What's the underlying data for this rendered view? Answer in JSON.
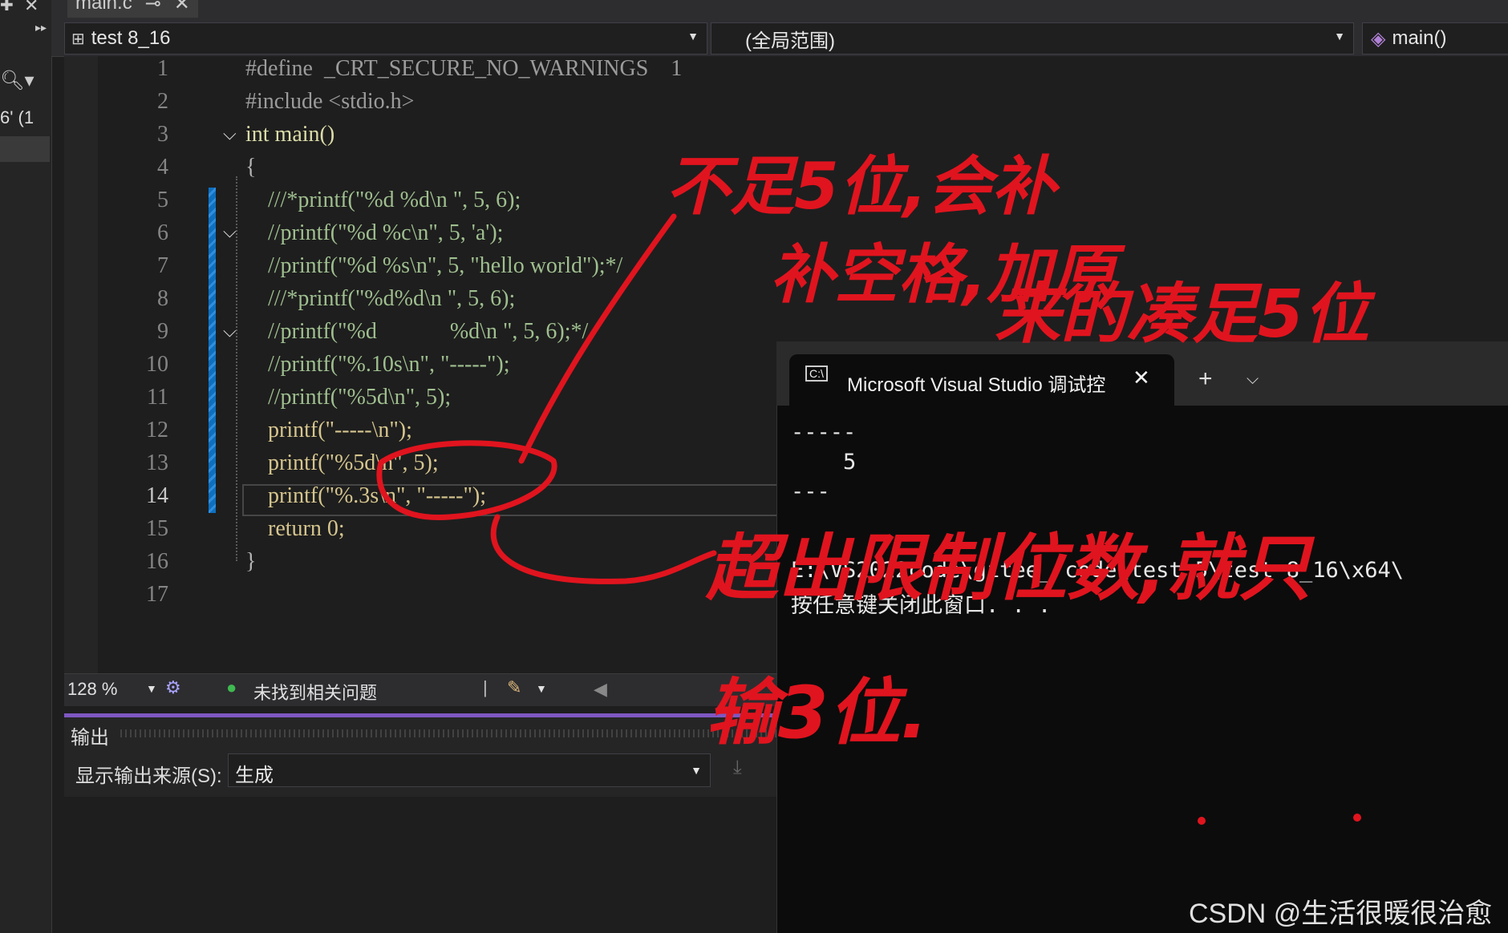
{
  "tab": {
    "title": "main.c",
    "pin_icon": "pin-icon",
    "close_icon": "close-icon"
  },
  "left_strip": {
    "search_icon": "search-icon",
    "crumb": "6' (1"
  },
  "navbar": {
    "project": "test 8_16",
    "scope": "(全局范围)",
    "function": "main()"
  },
  "editor": {
    "line_numbers": [
      "1",
      "2",
      "3",
      "4",
      "5",
      "6",
      "7",
      "8",
      "9",
      "10",
      "11",
      "12",
      "13",
      "14",
      "15",
      "16",
      "17"
    ],
    "lines": [
      "#define  _CRT_SECURE_NO_WARNINGS    1",
      "#include <stdio.h>",
      "int main()",
      "{",
      "    ///*printf(\"%d %d\\n \", 5, 6);",
      "    //printf(\"%d %c\\n\", 5, 'a');",
      "    //printf(\"%d %s\\n\", 5, \"hello world\");*/",
      "    ///*printf(\"%d%d\\n \", 5, 6);",
      "    //printf(\"%d             %d\\n \", 5, 6);*/",
      "    //printf(\"%.10s\\n\", \"-----\");",
      "    //printf(\"%5d\\n\", 5);",
      "    printf(\"-----\\n\");",
      "    printf(\"%5d\\n\", 5);",
      "    printf(\"%.3s\\n\", \"-----\");",
      "    return 0;",
      "}",
      ""
    ],
    "current_line": 14
  },
  "status": {
    "zoom": "128 %",
    "issues": "未找到相关问题"
  },
  "output": {
    "title": "输出",
    "source_label": "显示输出来源(S):",
    "source_value": "生成"
  },
  "console": {
    "title": "Microsoft Visual Studio 调试控",
    "lines": [
      "-----",
      "    5",
      "---",
      "",
      "E:\\VS2022code\\gitee_ code\\test 5\\test 8_16\\x64\\",
      "按任意键关闭此窗口. . ."
    ]
  },
  "annotations": {
    "color": "#e0141e",
    "note1": "不足5位,会补",
    "note2": "补空格,加原",
    "note3": "来的凑足5位",
    "note4": "超出限制位数,就只",
    "note5": "输3位."
  },
  "watermark": "CSDN @生活很暖很治愈"
}
